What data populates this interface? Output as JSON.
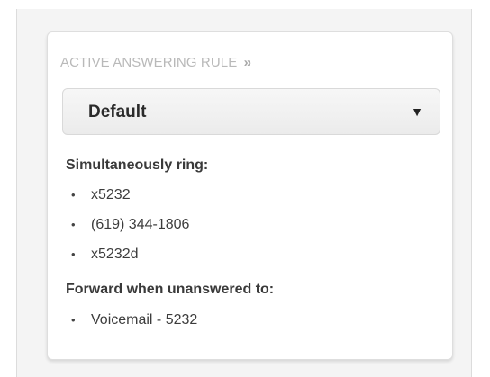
{
  "panel": {
    "heading": "ACTIVE ANSWERING RULE",
    "heading_chevron": "»",
    "rule_select": {
      "selected": "Default",
      "arrow": "▼"
    },
    "simultaneous": {
      "title": "Simultaneously ring:",
      "items": [
        "x5232",
        "(619) 344-1806",
        "x5232d"
      ]
    },
    "forward": {
      "title": "Forward when unanswered to:",
      "items": [
        "Voicemail - 5232"
      ]
    },
    "bullet": "•"
  }
}
